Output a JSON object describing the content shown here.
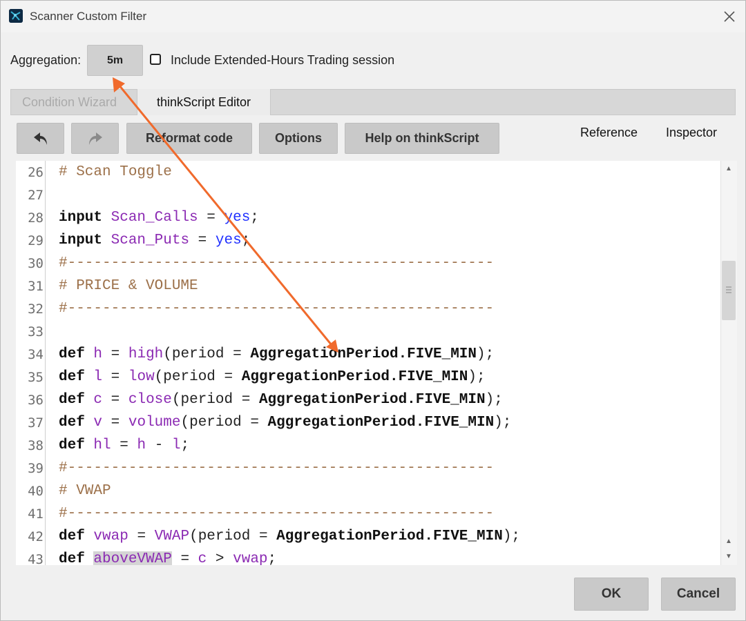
{
  "window": {
    "title": "Scanner Custom Filter"
  },
  "aggregation": {
    "label": "Aggregation:",
    "value": "5m"
  },
  "extended_hours": {
    "label": "Include Extended-Hours Trading session",
    "checked": false
  },
  "tabs": {
    "wizard": "Condition Wizard",
    "editor": "thinkScript Editor"
  },
  "toolbar": {
    "reformat": "Reformat code",
    "options": "Options",
    "help": "Help on thinkScript",
    "reference": "Reference",
    "inspector": "Inspector"
  },
  "editor": {
    "line_numbers": [
      "26",
      "27",
      "28",
      "29",
      "30",
      "31",
      "32",
      "33",
      "34",
      "35",
      "36",
      "37",
      "38",
      "39",
      "40",
      "41",
      "42",
      "43"
    ],
    "lines": [
      "# Scan Toggle",
      "",
      "input Scan_Calls = yes;",
      "input Scan_Puts = yes;",
      "#-------------------------------------------------",
      "# PRICE & VOLUME",
      "#-------------------------------------------------",
      "",
      "def h = high(period = AggregationPeriod.FIVE_MIN);",
      "def l = low(period = AggregationPeriod.FIVE_MIN);",
      "def c = close(period = AggregationPeriod.FIVE_MIN);",
      "def v = volume(period = AggregationPeriod.FIVE_MIN);",
      "def hl = h - l;",
      "#-------------------------------------------------",
      "# VWAP",
      "#-------------------------------------------------",
      "def vwap = VWAP(period = AggregationPeriod.FIVE_MIN);",
      "def aboveVWAP = c > vwap;"
    ],
    "highlighted_word": "aboveVWAP"
  },
  "footer": {
    "ok": "OK",
    "cancel": "Cancel"
  },
  "colors": {
    "keyword": "#111111",
    "comment": "#9c7049",
    "variable": "#8b2ab3",
    "boolean": "#2030ff",
    "annotation_arrow": "#f06a2c"
  }
}
